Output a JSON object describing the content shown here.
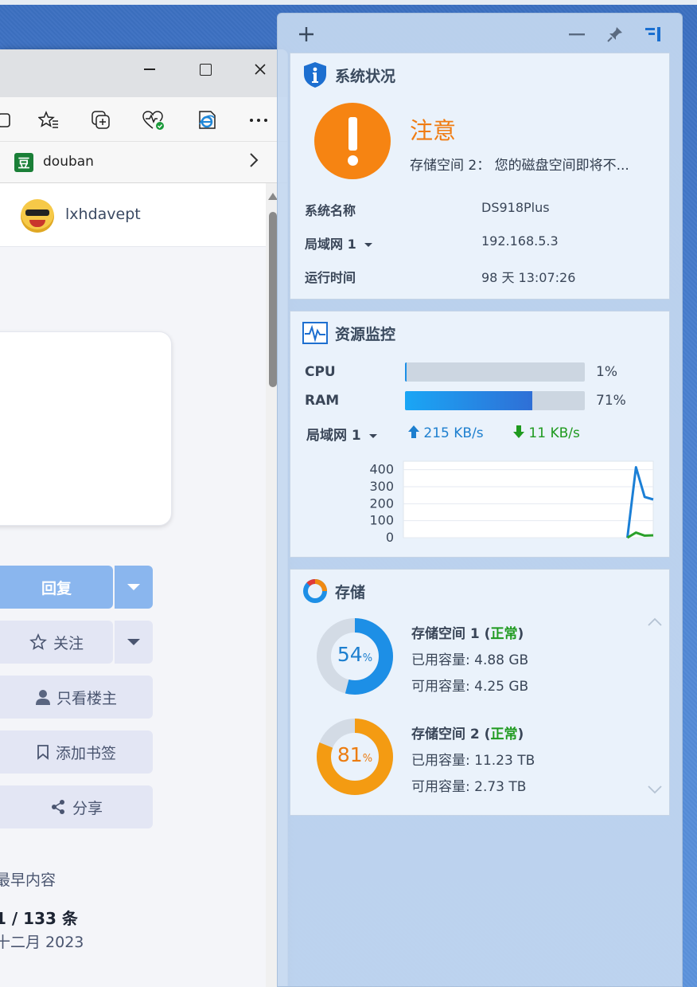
{
  "browser": {
    "favorites": {
      "item_label": "douban"
    },
    "user": {
      "name": "lxhdavept"
    },
    "buttons": {
      "reply": "回复",
      "follow": "关注",
      "only_op": "只看楼主",
      "bookmark": "添加书签",
      "share": "分享"
    },
    "meta": {
      "earliest": "最早内容",
      "count": "1 / 133 条",
      "date": "十二月 2023"
    }
  },
  "nas": {
    "status": {
      "title": "系统状况",
      "alert_title": "注意",
      "alert_message": "存储空间 2： 您的磁盘空间即将不...",
      "rows": [
        {
          "label": "系统名称",
          "value": "DS918Plus"
        },
        {
          "label": "局域网 1",
          "value": "192.168.5.3"
        },
        {
          "label": "运行时间",
          "value": "98 天 13:07:26"
        }
      ]
    },
    "resource": {
      "title": "资源监控",
      "cpu": {
        "label": "CPU",
        "percent": 1,
        "text": "1%"
      },
      "ram": {
        "label": "RAM",
        "percent": 71,
        "text": "71%"
      },
      "network": {
        "label": "局域网 1",
        "upload": "215 KB/s",
        "download": "11 KB/s"
      }
    },
    "storage": {
      "title": "存储",
      "volumes": [
        {
          "name": "存储空间 1",
          "status": "正常",
          "used": "已用容量: 4.88 GB",
          "free": "可用容量: 4.25 GB",
          "percent": 54,
          "percent_num": "54",
          "percent_sym": "%"
        },
        {
          "name": "存储空间 2",
          "status": "正常",
          "used": "已用容量: 11.23 TB",
          "free": "可用容量: 2.73 TB",
          "percent": 81,
          "percent_num": "81",
          "percent_sym": "%"
        }
      ]
    }
  },
  "chart_data": {
    "type": "line",
    "title": "",
    "xlabel": "",
    "ylabel": "",
    "ylim": [
      0,
      450
    ],
    "yticks": [
      "400",
      "300",
      "200",
      "100",
      "0"
    ],
    "grid": true,
    "x": [
      0,
      1,
      2,
      3,
      4,
      5,
      6,
      7,
      8,
      9,
      10,
      11,
      12,
      13,
      14,
      15,
      16,
      17,
      18,
      19,
      20,
      21,
      22,
      23,
      24,
      25,
      26,
      27,
      28,
      29
    ],
    "series": [
      {
        "color": "#1b7fd6",
        "values": [
          0,
          0,
          0,
          0,
          0,
          0,
          0,
          0,
          0,
          0,
          0,
          0,
          0,
          0,
          0,
          0,
          0,
          0,
          0,
          0,
          0,
          0,
          0,
          0,
          0,
          0,
          0,
          415,
          240,
          225
        ]
      },
      {
        "color": "#2aa02a",
        "values": [
          0,
          0,
          0,
          0,
          0,
          0,
          0,
          0,
          0,
          0,
          0,
          0,
          0,
          0,
          0,
          0,
          0,
          0,
          0,
          0,
          0,
          0,
          0,
          0,
          0,
          0,
          0,
          30,
          12,
          14
        ]
      }
    ]
  }
}
